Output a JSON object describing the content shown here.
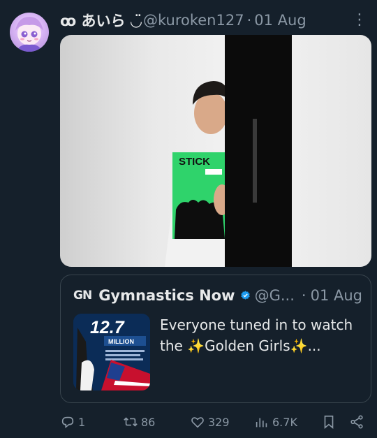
{
  "tweet": {
    "display_name": "ꝏ あいら ◡̈",
    "handle": "@kuroken127",
    "separator": "·",
    "date": "01 Aug",
    "more_icon": "more-vertical-icon"
  },
  "media": {
    "magazine_label": "STICK"
  },
  "quote": {
    "logo_text": "GN",
    "name": "Gymnastics Now",
    "handle": "@G...",
    "separator": "·",
    "date": "01 Aug",
    "text": "Everyone tuned in to watch the ✨Golden Girls✨...",
    "thumb_number": "12.7",
    "thumb_unit": "MILLION"
  },
  "actions": {
    "replies": "1",
    "retweets": "86",
    "likes": "329",
    "views": "6.7K"
  },
  "colors": {
    "background": "#15202b",
    "accent": "#1d9bf0",
    "muted": "#8b98a5"
  }
}
